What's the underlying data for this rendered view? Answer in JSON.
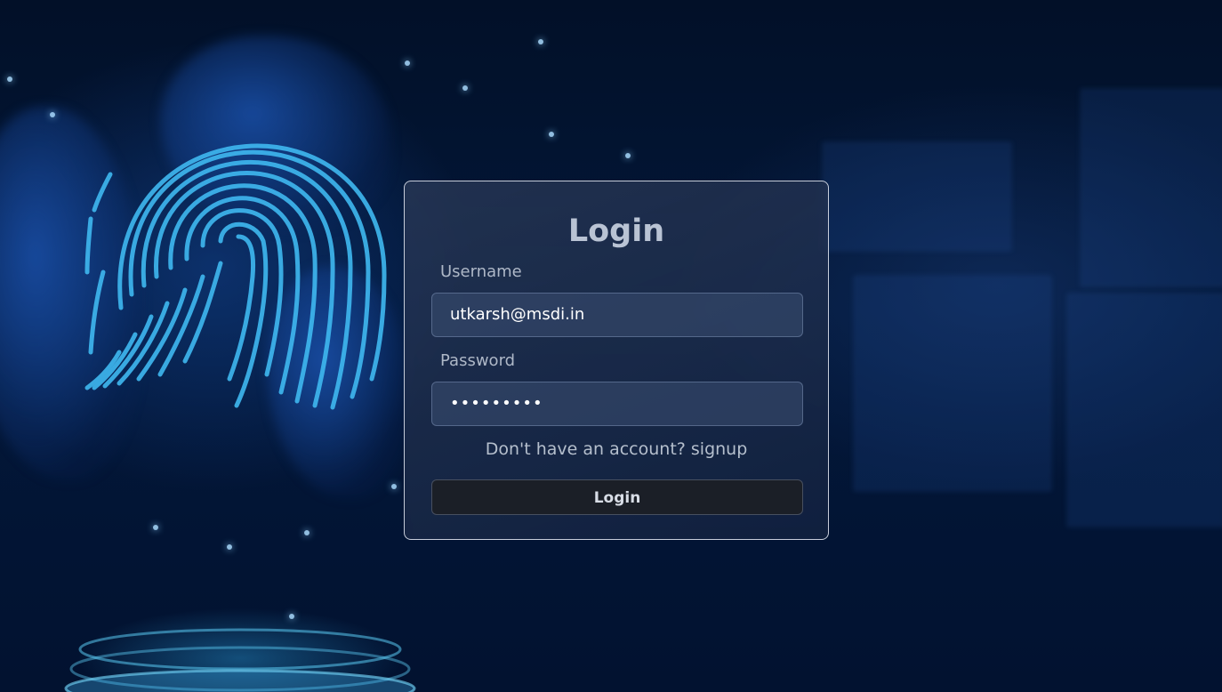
{
  "login_form": {
    "title": "Login",
    "username_label": "Username",
    "username_value": "utkarsh@msdi.in",
    "password_label": "Password",
    "password_masked": "•••••••••",
    "signup_prompt": "Don't have an account?",
    "signup_link": "signup",
    "submit_label": "Login"
  },
  "colors": {
    "background": "#03183a",
    "card_border": "#e6ebf5",
    "title_text": "#b9c3d4",
    "button_background": "#1b1f27",
    "fingerprint": "#3fb8f0"
  },
  "decoration": {
    "background_icon": "fingerprint-icon"
  }
}
